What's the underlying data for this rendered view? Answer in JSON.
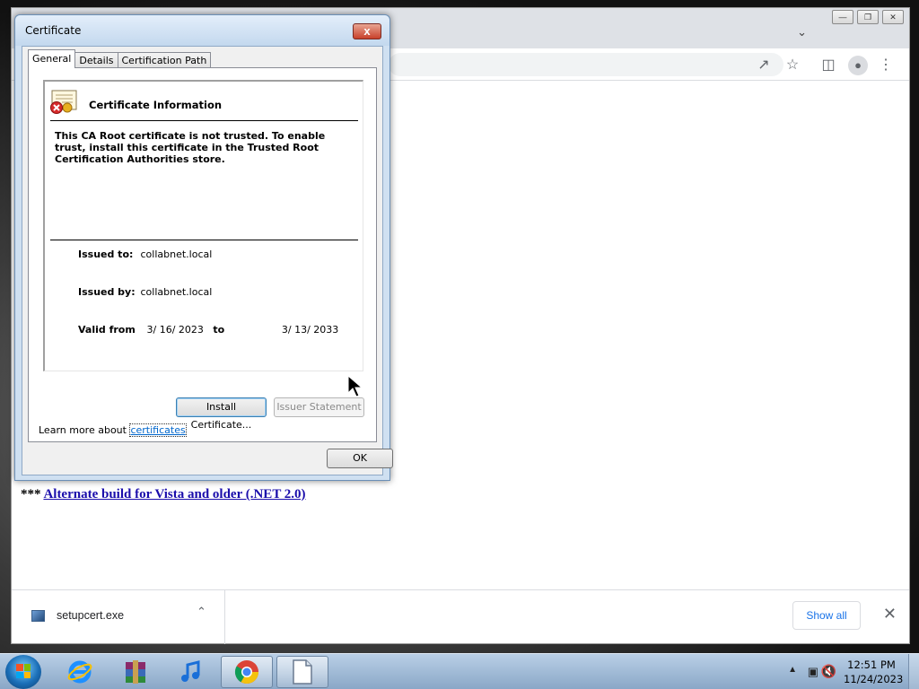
{
  "dialog": {
    "title": "Certificate",
    "close_label": "x",
    "tabs": [
      {
        "label": "General",
        "active": true
      },
      {
        "label": "Details",
        "active": false
      },
      {
        "label": "Certification Path",
        "active": false
      }
    ],
    "info_title": "Certificate Information",
    "warning": "This CA Root certificate is not trusted. To enable trust, install this certificate in the Trusted Root Certification Authorities store.",
    "issued_to_label": "Issued to:",
    "issued_to_value": "collabnet.local",
    "issued_by_label": "Issued by:",
    "issued_by_value": "collabnet.local",
    "valid_from_label": "Valid from",
    "valid_from_value": "3/ 16/ 2023",
    "valid_to_label": "to",
    "valid_to_value": "3/ 13/ 2033",
    "install_button": "Install Certificate...",
    "issuer_statement_button": "Issuer Statement",
    "learn_more_prefix": "Learn more about",
    "learn_more_link": "certificates",
    "ok_button": "OK"
  },
  "browser": {
    "page_prefix": "***",
    "alt_build_link": "Alternate build for Vista and older (.NET 2.0)",
    "download": {
      "filename": "setupcert.exe"
    },
    "show_all": "Show all"
  },
  "taskbar": {
    "time": "12:51 PM",
    "date": "11/24/2023",
    "apps": [
      "internet-explorer",
      "winrar",
      "itunes",
      "chrome",
      "notepad"
    ]
  },
  "colors": {
    "link": "#1a0dab",
    "show_all": "#1a73e8",
    "dialog_frame": "#cfe0f1"
  }
}
